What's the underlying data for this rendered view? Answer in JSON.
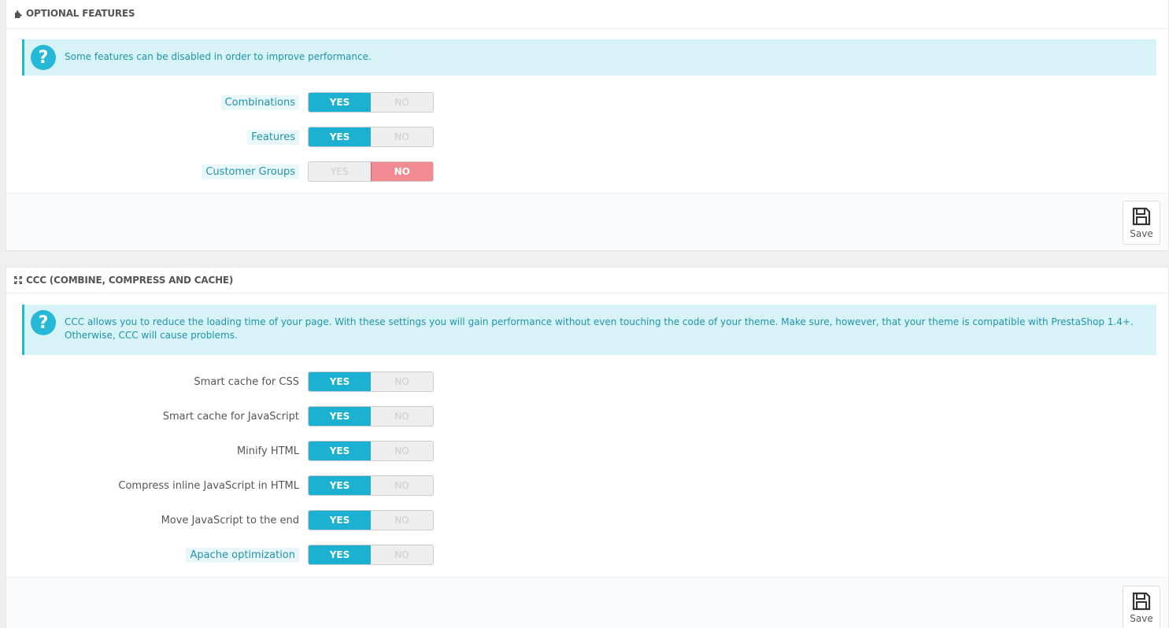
{
  "sections": [
    {
      "title": "OPTIONAL FEATURES",
      "icon": "puzzle-icon",
      "alert": "Some features can be disabled in order to improve performance.",
      "fields": [
        {
          "label": "Combinations",
          "hint": true,
          "value": "YES"
        },
        {
          "label": "Features",
          "hint": true,
          "value": "YES"
        },
        {
          "label": "Customer Groups",
          "hint": true,
          "value": "NO"
        }
      ],
      "save_label": "Save"
    },
    {
      "title": "CCC (COMBINE, COMPRESS AND CACHE)",
      "icon": "expand-icon",
      "alert": "CCC allows you to reduce the loading time of your page. With these settings you will gain performance without even touching the code of your theme. Make sure, however, that your theme is compatible with PrestaShop 1.4+. Otherwise, CCC will cause problems.",
      "fields": [
        {
          "label": "Smart cache for CSS",
          "hint": false,
          "value": "YES"
        },
        {
          "label": "Smart cache for JavaScript",
          "hint": false,
          "value": "YES"
        },
        {
          "label": "Minify HTML",
          "hint": false,
          "value": "YES"
        },
        {
          "label": "Compress inline JavaScript in HTML",
          "hint": false,
          "value": "YES"
        },
        {
          "label": "Move JavaScript to the end",
          "hint": false,
          "value": "YES"
        },
        {
          "label": "Apache optimization",
          "hint": true,
          "value": "YES"
        }
      ],
      "save_label": "Save"
    }
  ],
  "switch_labels": {
    "yes": "YES",
    "no": "NO"
  },
  "colors": {
    "accent": "#25b9d7",
    "yes_on": "#1cb0d2",
    "no_on": "#ef8b91",
    "alert_bg": "#d7f3f7"
  }
}
